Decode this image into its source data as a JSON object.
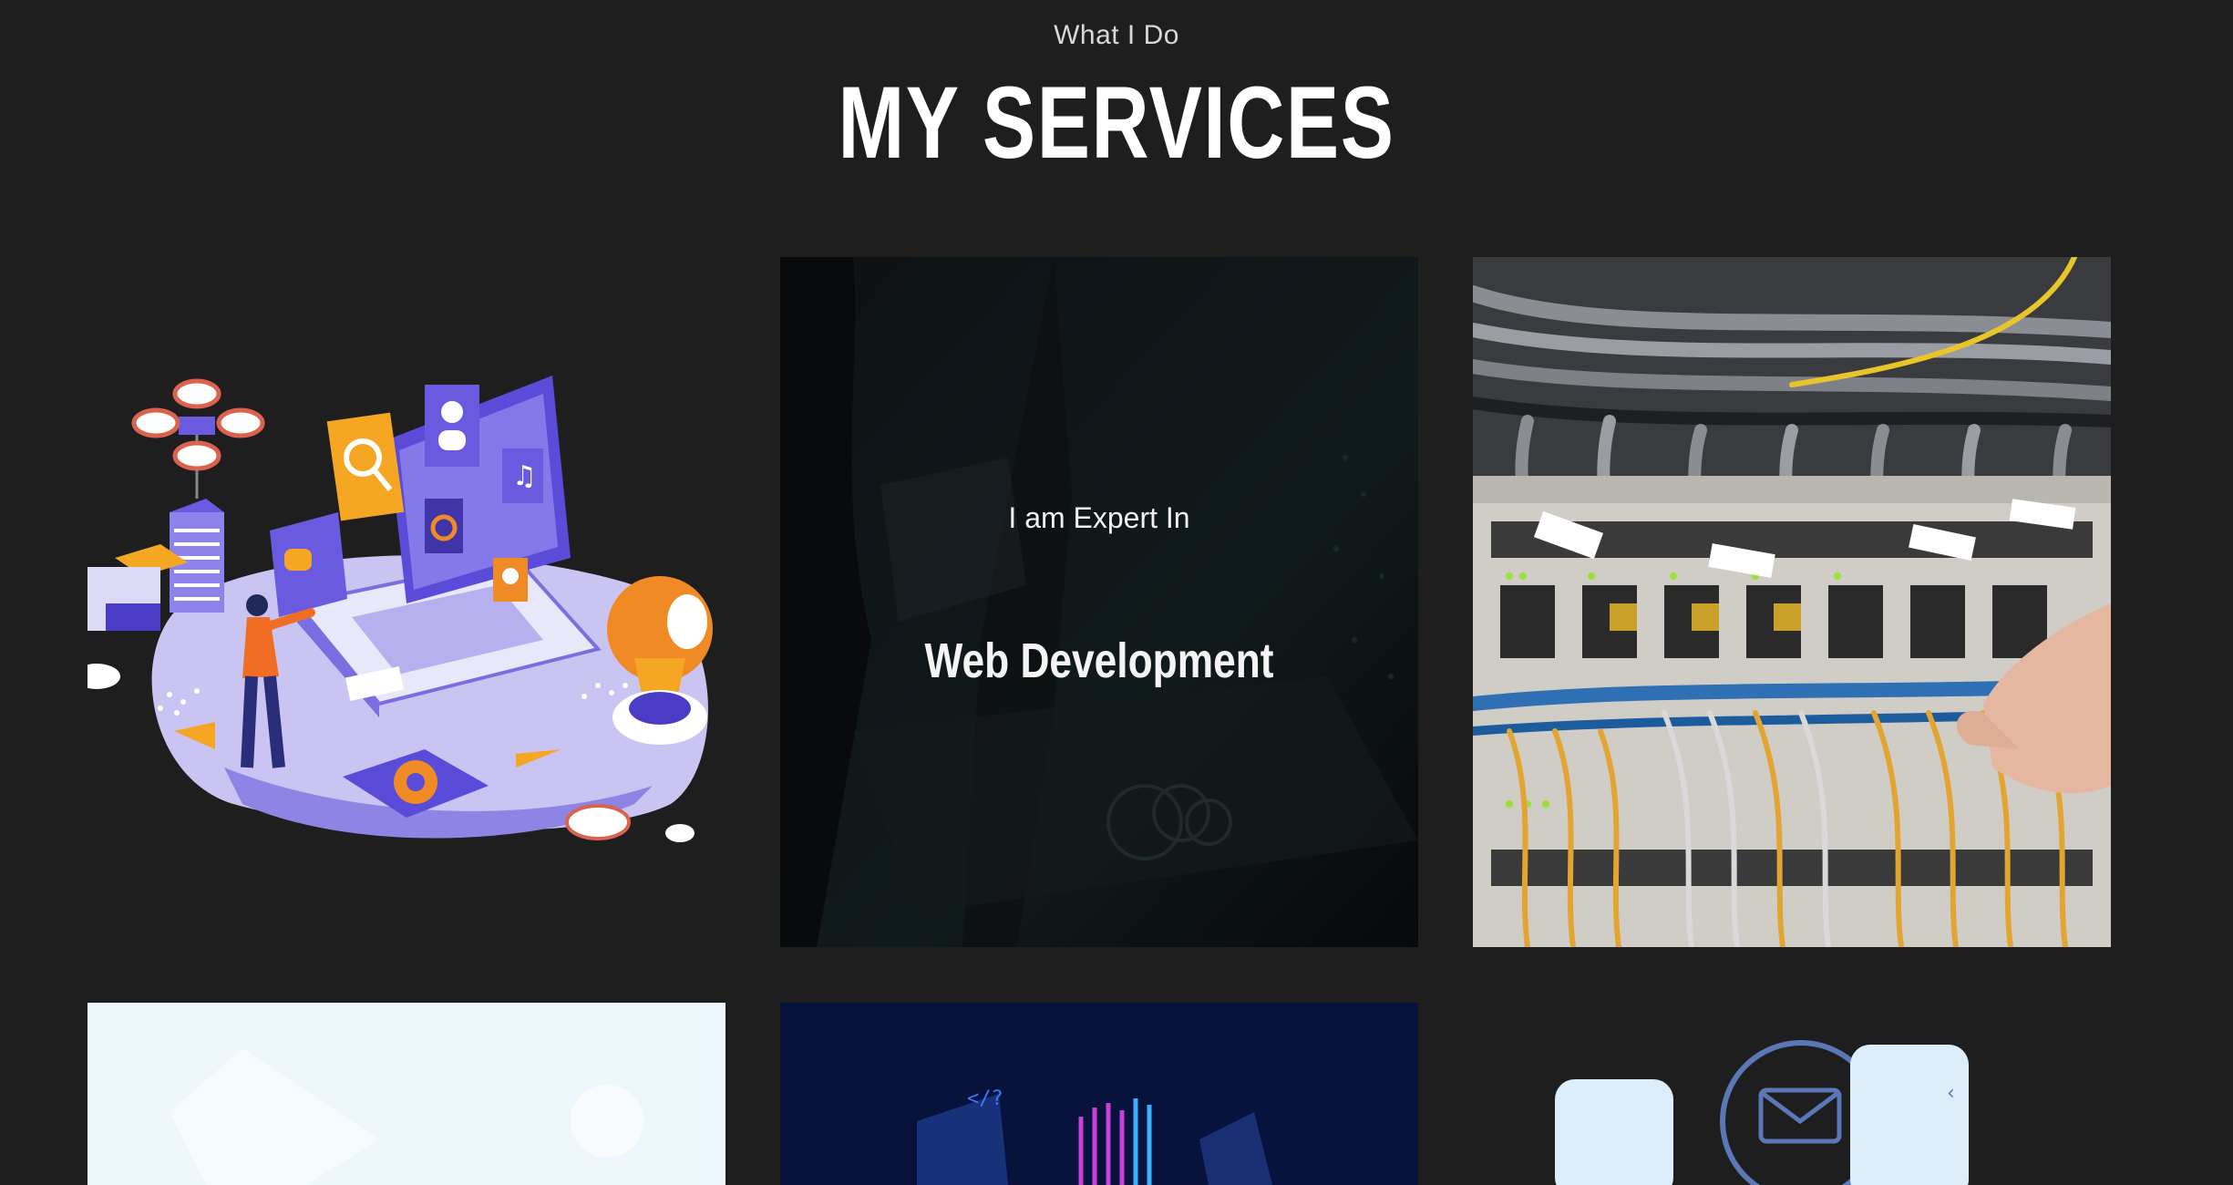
{
  "section": {
    "eyebrow": "What I Do",
    "title": "MY SERVICES"
  },
  "cards": [
    {
      "name": "service-card-illustration",
      "image": "isometric-laptop-illustration"
    },
    {
      "name": "service-card-web-development",
      "overlay_subtitle": "I am Expert In",
      "overlay_title": "Web Development"
    },
    {
      "name": "service-card-network-cabling",
      "image": "network-switch-cables-photo"
    },
    {
      "name": "service-card-mobile",
      "image": "light-blue-device-illustration"
    },
    {
      "name": "service-card-code",
      "image": "dark-blue-code-illustration"
    },
    {
      "name": "service-card-email",
      "image": "email-icon-illustration"
    }
  ],
  "colors": {
    "background": "#1e1e1e",
    "text": "#ffffff",
    "accent_purple": "#6a5ae0",
    "accent_orange": "#f08a24"
  }
}
